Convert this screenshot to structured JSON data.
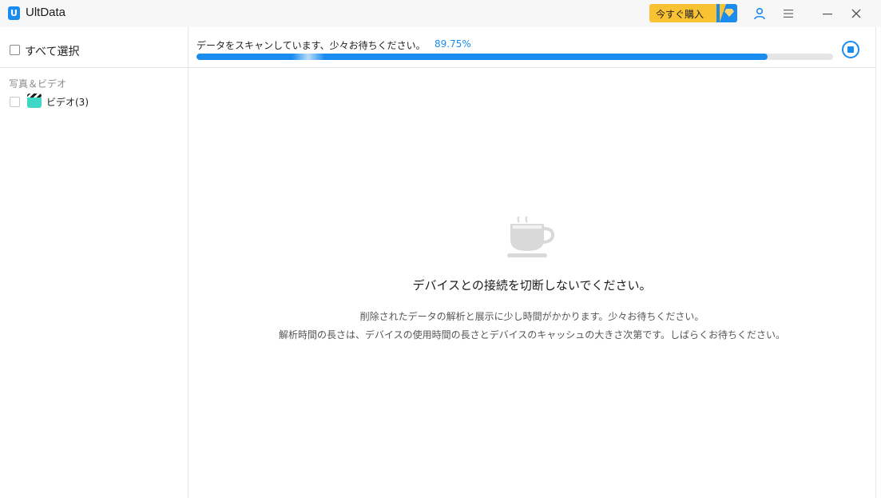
{
  "window": {
    "title": "UltData",
    "buy_label": "今すぐ購入"
  },
  "sidebar": {
    "select_all_label": "すべて選択",
    "categories": [
      {
        "title": "写真＆ビデオ",
        "items": [
          {
            "label": "ビデオ(3)",
            "icon": "video-clapper-icon"
          }
        ]
      }
    ]
  },
  "scan": {
    "status_text": "データをスキャンしています、少々お待ちください。",
    "percent_text": "89.75%",
    "progress": 0.8975
  },
  "message": {
    "headline": "デバイスとの接続を切断しないでください。",
    "line1": "削除されたデータの解析と展示に少し時間がかかります。少々お待ちください。",
    "line2": "解析時間の長さは、デバイスの使用時間の長さとデバイスのキャッシュの大きさ次第です。しばらくお待ちください。"
  },
  "colors": {
    "accent": "#1a8cf0",
    "buy_button": "#f8c233"
  }
}
